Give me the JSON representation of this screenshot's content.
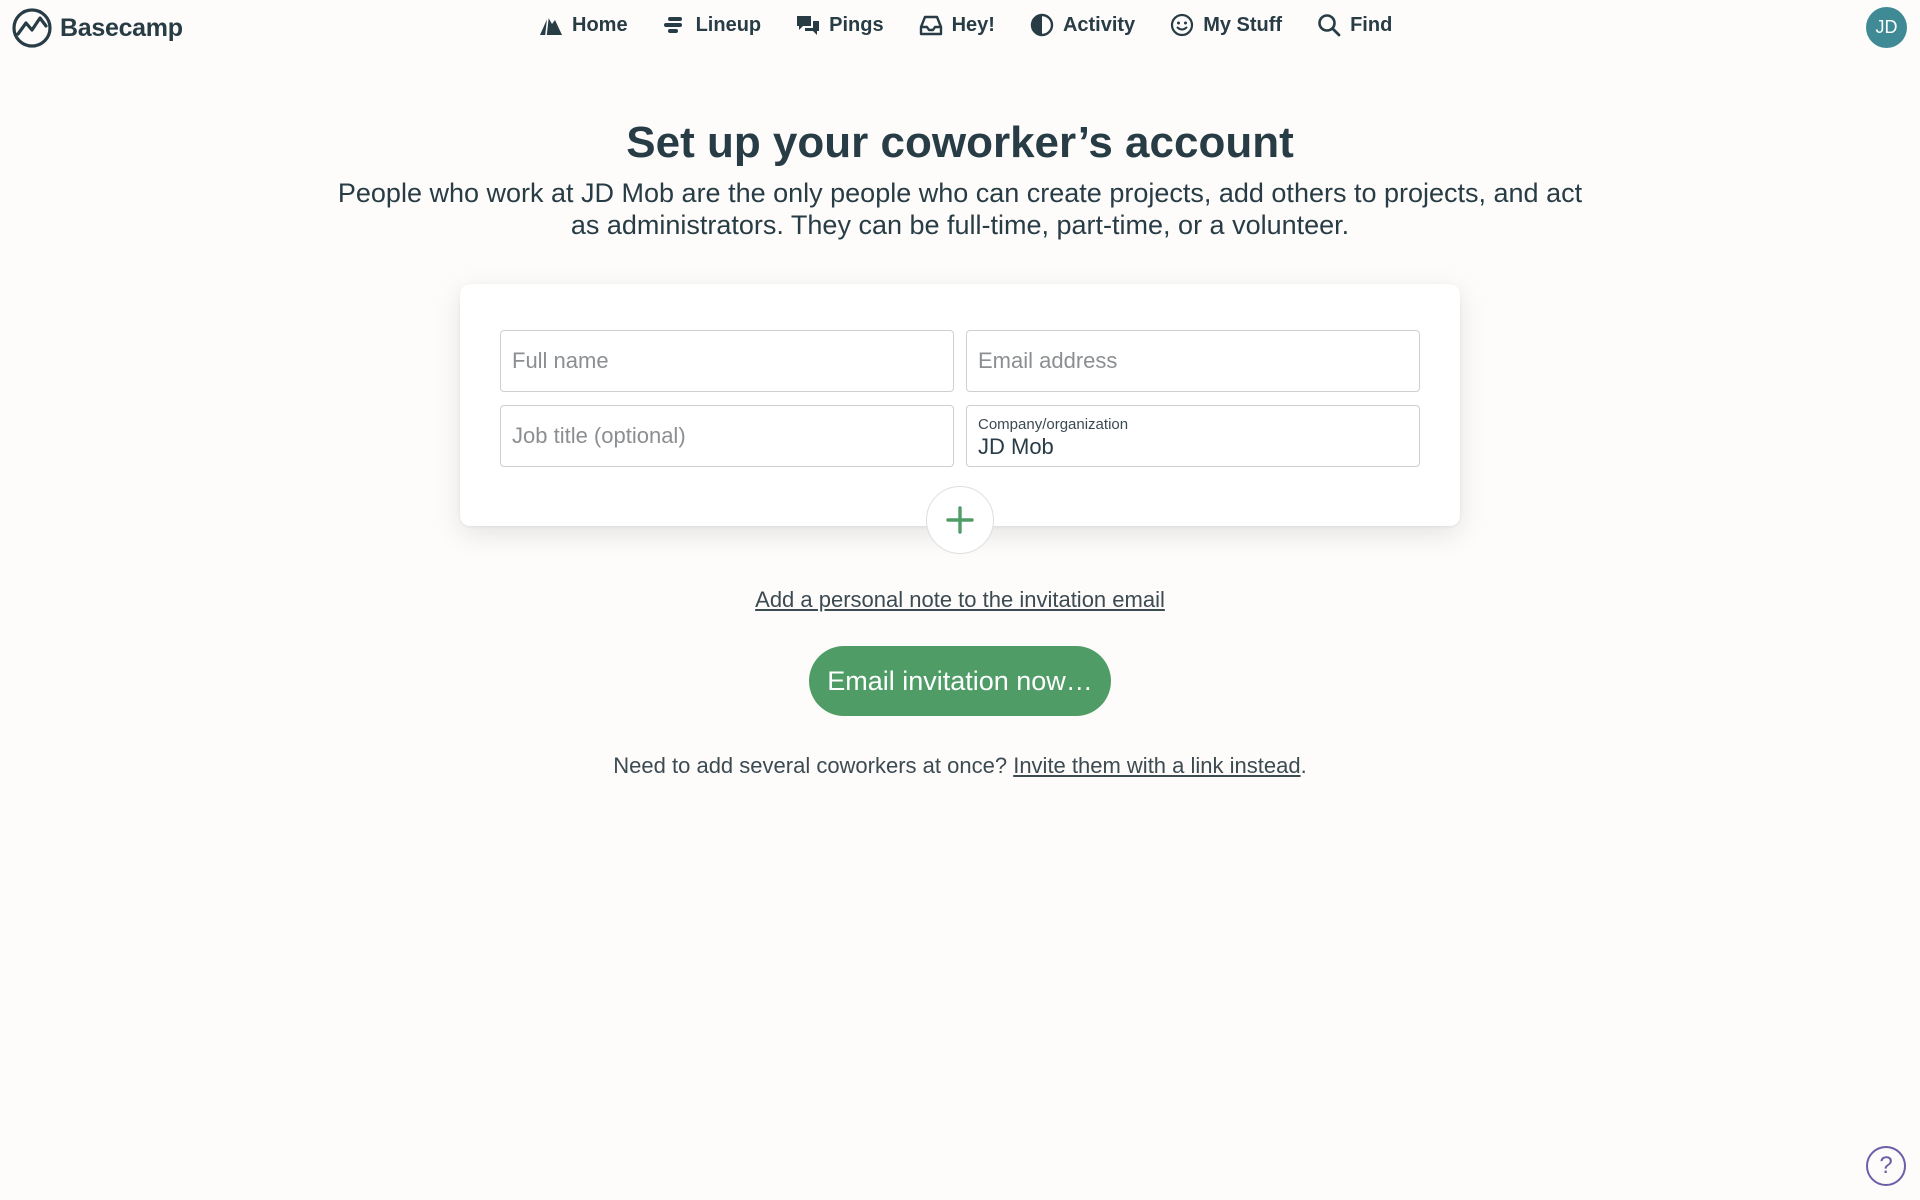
{
  "app": {
    "name": "Basecamp"
  },
  "nav": {
    "items": [
      {
        "label": "Home",
        "icon": "mountain-icon"
      },
      {
        "label": "Lineup",
        "icon": "lineup-icon"
      },
      {
        "label": "Pings",
        "icon": "chat-bubbles-icon"
      },
      {
        "label": "Hey!",
        "icon": "inbox-tray-icon"
      },
      {
        "label": "Activity",
        "icon": "half-circle-icon"
      },
      {
        "label": "My Stuff",
        "icon": "smiley-icon"
      },
      {
        "label": "Find",
        "icon": "search-icon"
      }
    ],
    "avatar_initials": "JD"
  },
  "page": {
    "title": "Set up your coworker’s account",
    "intro": "People who work at JD Mob are the only people who can create projects, add others to projects, and act as administrators. They can be full-time, part-time, or a volunteer."
  },
  "form": {
    "full_name": {
      "placeholder": "Full name",
      "value": ""
    },
    "email": {
      "placeholder": "Email address",
      "value": ""
    },
    "job_title": {
      "placeholder": "Job title (optional)",
      "value": ""
    },
    "company": {
      "label": "Company/organization",
      "value": "JD Mob"
    },
    "add_another_icon": "plus-icon"
  },
  "actions": {
    "personal_note_link": "Add a personal note to the invitation email",
    "submit_label": "Email invitation now…",
    "footer_prefix": "Need to add several coworkers at once?",
    "footer_link": "Invite them with a link instead",
    "footer_suffix": "."
  },
  "help": {
    "label": "?"
  },
  "colors": {
    "background": "#fdfcfa",
    "text": "#283c46",
    "primary_button": "#4f9c67",
    "avatar": "#3f8a94",
    "help": "#6a5fa8"
  }
}
